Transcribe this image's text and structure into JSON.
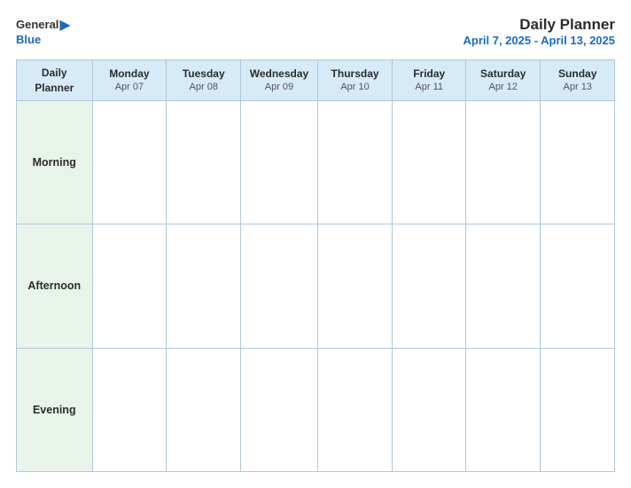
{
  "header": {
    "logo": {
      "general": "General",
      "blue": "Blue",
      "arrow": "▶"
    },
    "title": "Daily Planner",
    "date_range": "April 7, 2025 - April 13, 2025"
  },
  "table": {
    "header_label": "Daily\nPlanner",
    "columns": [
      {
        "day": "Monday",
        "date": "Apr 07"
      },
      {
        "day": "Tuesday",
        "date": "Apr 08"
      },
      {
        "day": "Wednesday",
        "date": "Apr 09"
      },
      {
        "day": "Thursday",
        "date": "Apr 10"
      },
      {
        "day": "Friday",
        "date": "Apr 11"
      },
      {
        "day": "Saturday",
        "date": "Apr 12"
      },
      {
        "day": "Sunday",
        "date": "Apr 13"
      }
    ],
    "rows": [
      {
        "label": "Morning"
      },
      {
        "label": "Afternoon"
      },
      {
        "label": "Evening"
      }
    ]
  }
}
